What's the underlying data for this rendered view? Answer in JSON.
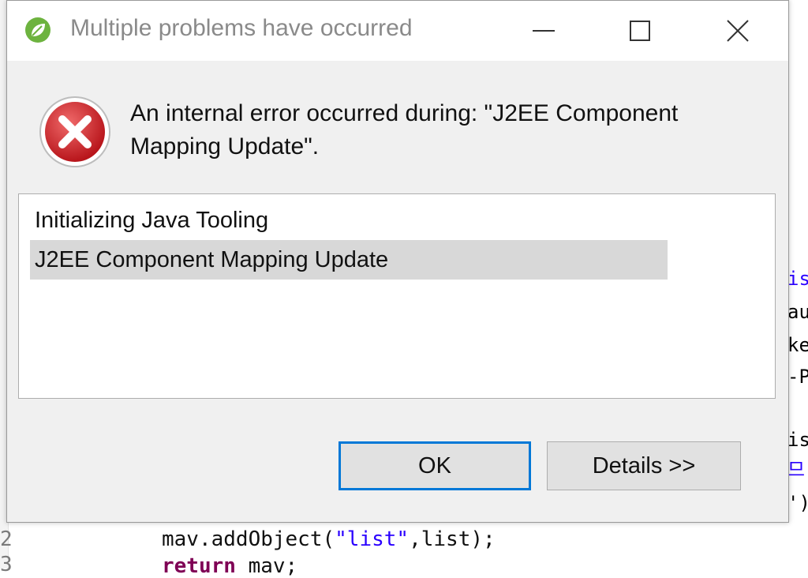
{
  "dialog": {
    "title": "Multiple problems have occurred",
    "message": "An internal error occurred during: \"J2EE Component Mapping Update\".",
    "problems": [
      {
        "label": "Initializing Java Tooling",
        "selected": false
      },
      {
        "label": "J2EE Component Mapping Update",
        "selected": true
      }
    ],
    "ok_label": "OK",
    "details_label": "Details >>"
  },
  "editor": {
    "line_numbers": [
      "2",
      "3"
    ],
    "code_lines": [
      "mav.addObject(\"list\",list);",
      "return mav;"
    ],
    "right_fragments": [
      "is",
      "au",
      "ke",
      "-P",
      "is",
      "므'",
      "')"
    ]
  },
  "icons": {
    "app": "spring-leaf-icon",
    "error": "error-x-icon"
  },
  "colors": {
    "focus_border": "#0078d7",
    "error_red": "#d9363e",
    "selection": "#d8d8d8"
  }
}
